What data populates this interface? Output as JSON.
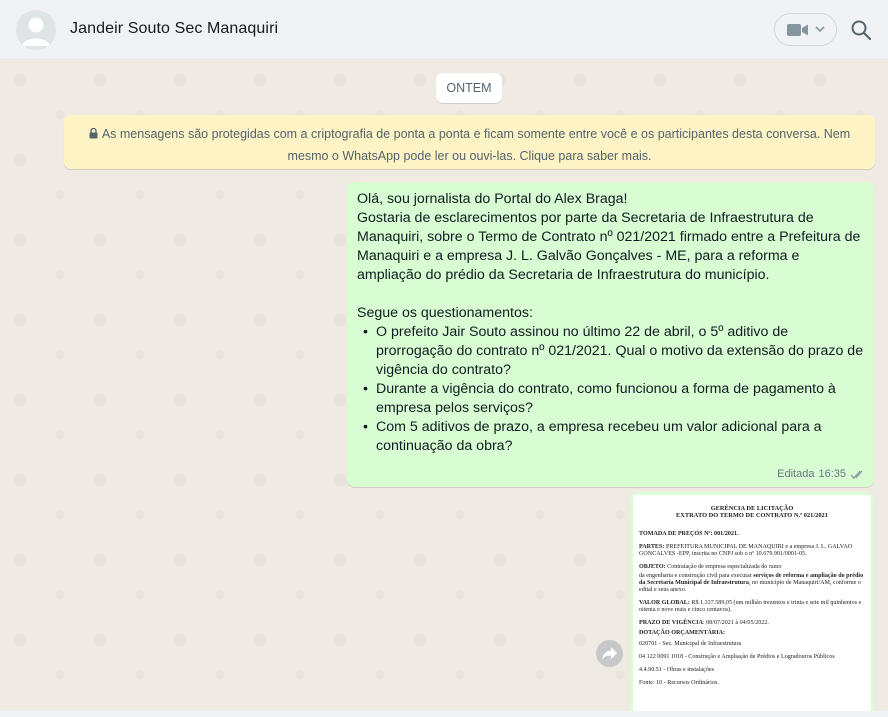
{
  "header": {
    "contact_name": "Jandeir Souto Sec Manaquiri",
    "icons": [
      "default-avatar-icon",
      "video-camera-icon",
      "chevron-down-icon",
      "search-icon"
    ]
  },
  "chat": {
    "date_chip": "ONTEM",
    "encryption_notice": "As mensagens são protegidas com a criptografia de ponta a ponta e ficam somente entre você e os participantes desta conversa. Nem mesmo o WhatsApp pode ler ou ouvi-las. Clique para saber mais.",
    "message": {
      "line1": "Olá, sou jornalista do Portal do Alex Braga!",
      "paragraph1": "Gostaria de esclarecimentos por parte da Secretaria de Infraestrutura de Manaquiri, sobre o Termo de Contrato nº 021/2021 firmado entre a Prefeitura de Manaquiri e a empresa J. L. Galvão Gonçalves - ME, para a reforma e ampliação do prédio da Secretaria de Infraestrutura do município.",
      "intro": "Segue os questionamentos:",
      "questions": [
        "O prefeito Jair Souto assinou no último 22 de abril, o 5º aditivo de prorrogação do contrato nº 021/2021. Qual o motivo da extensão do prazo de vigência do contrato?",
        "Durante a vigência do contrato, como funcionou a forma de pagamento à empresa pelos serviços?",
        "Com 5 aditivos de prazo, a empresa recebeu um valor adicional para a continuação da obra?"
      ],
      "edited_label": "Editada",
      "time": "16:35",
      "status": "read-ticks-icon"
    },
    "document": {
      "heading1": "GERÊNCIA DE LICITAÇÃO",
      "heading2": "EXTRATO DO TERMO DE CONTRATO N.º 021/2021",
      "tomada_label": "TOMADA DE PREÇOS Nº:",
      "tomada_value": "001/2021.",
      "partes_label": "PARTES:",
      "partes_value": "PREFEITURA MUNICIPAL DE MANAQUIRI e a empresa J. L. GALVAO GONCALVES -EPP, inscrita no CNPJ sob o nº 10.679.901/0001-05.",
      "objeto_label": "OBJETO:",
      "objeto_value": "Contratação de empresa especializada do ramo",
      "objeto_value2a": "da engenharia e construção civil para executar",
      "objeto_value2b": "serviços de reforma e ampliação do prédio da Secretaria Municipal de Infraestrutura",
      "objeto_value2c": ", no município de Manaquiri/AM, conforme o edital e seus anexo.",
      "valor_label": "VALOR GLOBAL:",
      "valor_value": "R$ 1.337.589,05 (um milhão trezentos e trinta e sete mil quinhentos e oitenta e nove reais e cinco centavos).",
      "prazo_label": "PRAZO DE VIGÊNCIA",
      "prazo_value": ": 08/07/2021 à 04/05/2022.",
      "dotacao_label": "DOTAÇÃO ORÇAMENTÁRIA:",
      "dotacao_1": "020701 - Sec. Municipal de Infraestrutura",
      "dotacao_2": "04 122 0091 1018 - Construção e Ampliação de Prédios e Logradouros Públicos",
      "dotacao_3": "4.4.90.51 - Obras e instalações",
      "dotacao_4": "Fonte: 10 - Recursos Ordinários."
    },
    "forward_icon": "forward-arrow-icon"
  },
  "colors": {
    "header_bg": "#f0f2f5",
    "chat_bg": "#efeae2",
    "outgoing_bubble": "#d9fdd3",
    "encryption_bg": "#fdf3c5",
    "read_ticks": "#8696a0"
  }
}
